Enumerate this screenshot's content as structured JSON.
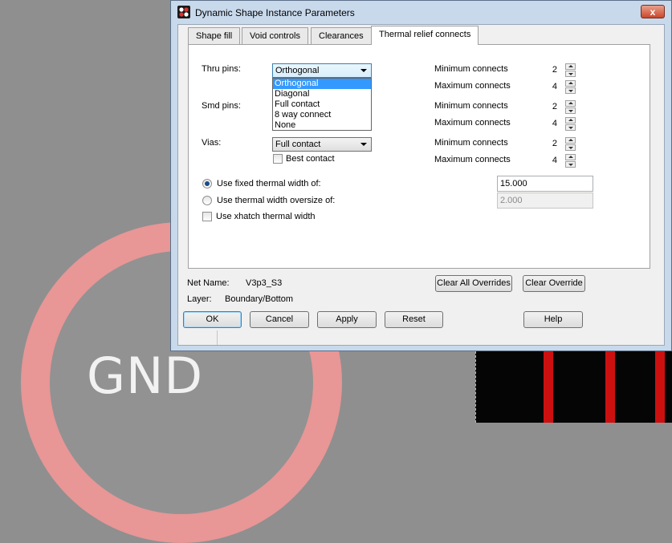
{
  "background": {
    "gnd_label": "GND"
  },
  "dialog": {
    "title": "Dynamic Shape Instance Parameters",
    "close_label": "x",
    "tabs": [
      {
        "label": "Shape fill"
      },
      {
        "label": "Void controls"
      },
      {
        "label": "Clearances"
      },
      {
        "label": "Thermal relief connects",
        "active": true
      }
    ],
    "thru_pins": {
      "label": "Thru pins:",
      "value": "Orthogonal",
      "options": [
        "Orthogonal",
        "Diagonal",
        "Full contact",
        "8 way connect",
        "None"
      ],
      "min_label": "Minimum connects",
      "min_value": "2",
      "max_label": "Maximum connects",
      "max_value": "4"
    },
    "smd_pins": {
      "label": "Smd pins:",
      "min_label": "Minimum connects",
      "min_value": "2",
      "max_label": "Maximum connects",
      "max_value": "4"
    },
    "vias": {
      "label": "Vias:",
      "value": "Full contact",
      "min_label": "Minimum connects",
      "min_value": "2",
      "max_label": "Maximum connects",
      "max_value": "4"
    },
    "best_contact_label": "Best contact",
    "fixed_width": {
      "label": "Use fixed thermal width of:",
      "value": "15.000"
    },
    "oversize_width": {
      "label": "Use thermal width oversize of:",
      "value": "2.000"
    },
    "xhatch_label": "Use xhatch thermal width",
    "net_name_label": "Net Name:",
    "net_name_value": "V3p3_S3",
    "layer_label": "Layer:",
    "layer_value": "Boundary/Bottom",
    "buttons": {
      "clear_all": "Clear All Overrides",
      "clear": "Clear Override",
      "ok": "OK",
      "cancel": "Cancel",
      "apply": "Apply",
      "reset": "Reset",
      "help": "Help"
    }
  }
}
